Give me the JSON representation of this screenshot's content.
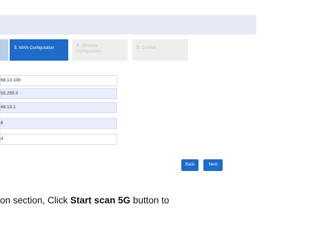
{
  "steps": [
    {
      "number": "",
      "label": "",
      "state": "done"
    },
    {
      "number": "3.",
      "label": "WAN Configuration",
      "state": "active"
    },
    {
      "number": "4.",
      "label_line1": "Wireless",
      "label_line2": "Configuration",
      "state": "pending"
    },
    {
      "number": "5.",
      "label": "Confirm",
      "state": "pending"
    }
  ],
  "fields": [
    {
      "value": "68.13.108"
    },
    {
      "value": "55.255.0"
    },
    {
      "value": "68.13.1"
    },
    {
      "value": "8"
    },
    {
      "value": "4"
    }
  ],
  "buttons": {
    "back_label": "Back",
    "next_label": "Next"
  },
  "caption": {
    "part1": "on section, Click ",
    "bold": "Start scan 5G",
    "part2": " button to"
  },
  "colors": {
    "accent": "#1e6bc9",
    "header_bar": "#e6e9f6",
    "row_shaded": "#e8eefb",
    "step_pending": "#eeeeee",
    "step_done": "#b8cde8"
  }
}
